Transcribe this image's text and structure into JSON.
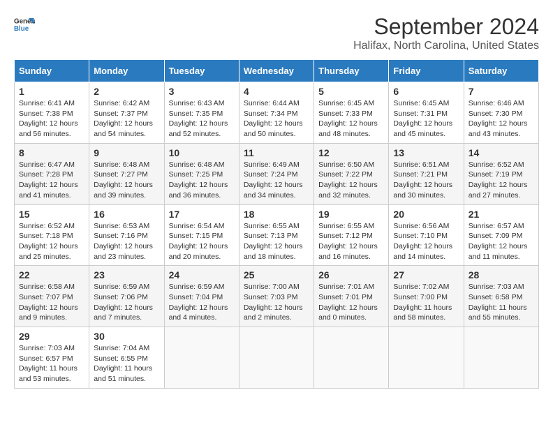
{
  "header": {
    "logo_general": "General",
    "logo_blue": "Blue",
    "title": "September 2024",
    "subtitle": "Halifax, North Carolina, United States"
  },
  "calendar": {
    "days_of_week": [
      "Sunday",
      "Monday",
      "Tuesday",
      "Wednesday",
      "Thursday",
      "Friday",
      "Saturday"
    ],
    "weeks": [
      [
        null,
        {
          "day": "2",
          "sunrise": "6:42 AM",
          "sunset": "7:37 PM",
          "daylight": "12 hours and 54 minutes."
        },
        {
          "day": "3",
          "sunrise": "6:43 AM",
          "sunset": "7:35 PM",
          "daylight": "12 hours and 52 minutes."
        },
        {
          "day": "4",
          "sunrise": "6:44 AM",
          "sunset": "7:34 PM",
          "daylight": "12 hours and 50 minutes."
        },
        {
          "day": "5",
          "sunrise": "6:45 AM",
          "sunset": "7:33 PM",
          "daylight": "12 hours and 48 minutes."
        },
        {
          "day": "6",
          "sunrise": "6:45 AM",
          "sunset": "7:31 PM",
          "daylight": "12 hours and 45 minutes."
        },
        {
          "day": "7",
          "sunrise": "6:46 AM",
          "sunset": "7:30 PM",
          "daylight": "12 hours and 43 minutes."
        }
      ],
      [
        {
          "day": "1",
          "sunrise": "6:41 AM",
          "sunset": "7:38 PM",
          "daylight": "12 hours and 56 minutes."
        },
        null,
        null,
        null,
        null,
        null,
        null
      ],
      [
        {
          "day": "8",
          "sunrise": "6:47 AM",
          "sunset": "7:28 PM",
          "daylight": "12 hours and 41 minutes."
        },
        {
          "day": "9",
          "sunrise": "6:48 AM",
          "sunset": "7:27 PM",
          "daylight": "12 hours and 39 minutes."
        },
        {
          "day": "10",
          "sunrise": "6:48 AM",
          "sunset": "7:25 PM",
          "daylight": "12 hours and 36 minutes."
        },
        {
          "day": "11",
          "sunrise": "6:49 AM",
          "sunset": "7:24 PM",
          "daylight": "12 hours and 34 minutes."
        },
        {
          "day": "12",
          "sunrise": "6:50 AM",
          "sunset": "7:22 PM",
          "daylight": "12 hours and 32 minutes."
        },
        {
          "day": "13",
          "sunrise": "6:51 AM",
          "sunset": "7:21 PM",
          "daylight": "12 hours and 30 minutes."
        },
        {
          "day": "14",
          "sunrise": "6:52 AM",
          "sunset": "7:19 PM",
          "daylight": "12 hours and 27 minutes."
        }
      ],
      [
        {
          "day": "15",
          "sunrise": "6:52 AM",
          "sunset": "7:18 PM",
          "daylight": "12 hours and 25 minutes."
        },
        {
          "day": "16",
          "sunrise": "6:53 AM",
          "sunset": "7:16 PM",
          "daylight": "12 hours and 23 minutes."
        },
        {
          "day": "17",
          "sunrise": "6:54 AM",
          "sunset": "7:15 PM",
          "daylight": "12 hours and 20 minutes."
        },
        {
          "day": "18",
          "sunrise": "6:55 AM",
          "sunset": "7:13 PM",
          "daylight": "12 hours and 18 minutes."
        },
        {
          "day": "19",
          "sunrise": "6:55 AM",
          "sunset": "7:12 PM",
          "daylight": "12 hours and 16 minutes."
        },
        {
          "day": "20",
          "sunrise": "6:56 AM",
          "sunset": "7:10 PM",
          "daylight": "12 hours and 14 minutes."
        },
        {
          "day": "21",
          "sunrise": "6:57 AM",
          "sunset": "7:09 PM",
          "daylight": "12 hours and 11 minutes."
        }
      ],
      [
        {
          "day": "22",
          "sunrise": "6:58 AM",
          "sunset": "7:07 PM",
          "daylight": "12 hours and 9 minutes."
        },
        {
          "day": "23",
          "sunrise": "6:59 AM",
          "sunset": "7:06 PM",
          "daylight": "12 hours and 7 minutes."
        },
        {
          "day": "24",
          "sunrise": "6:59 AM",
          "sunset": "7:04 PM",
          "daylight": "12 hours and 4 minutes."
        },
        {
          "day": "25",
          "sunrise": "7:00 AM",
          "sunset": "7:03 PM",
          "daylight": "12 hours and 2 minutes."
        },
        {
          "day": "26",
          "sunrise": "7:01 AM",
          "sunset": "7:01 PM",
          "daylight": "12 hours and 0 minutes."
        },
        {
          "day": "27",
          "sunrise": "7:02 AM",
          "sunset": "7:00 PM",
          "daylight": "11 hours and 58 minutes."
        },
        {
          "day": "28",
          "sunrise": "7:03 AM",
          "sunset": "6:58 PM",
          "daylight": "11 hours and 55 minutes."
        }
      ],
      [
        {
          "day": "29",
          "sunrise": "7:03 AM",
          "sunset": "6:57 PM",
          "daylight": "11 hours and 53 minutes."
        },
        {
          "day": "30",
          "sunrise": "7:04 AM",
          "sunset": "6:55 PM",
          "daylight": "11 hours and 51 minutes."
        },
        null,
        null,
        null,
        null,
        null
      ]
    ]
  }
}
